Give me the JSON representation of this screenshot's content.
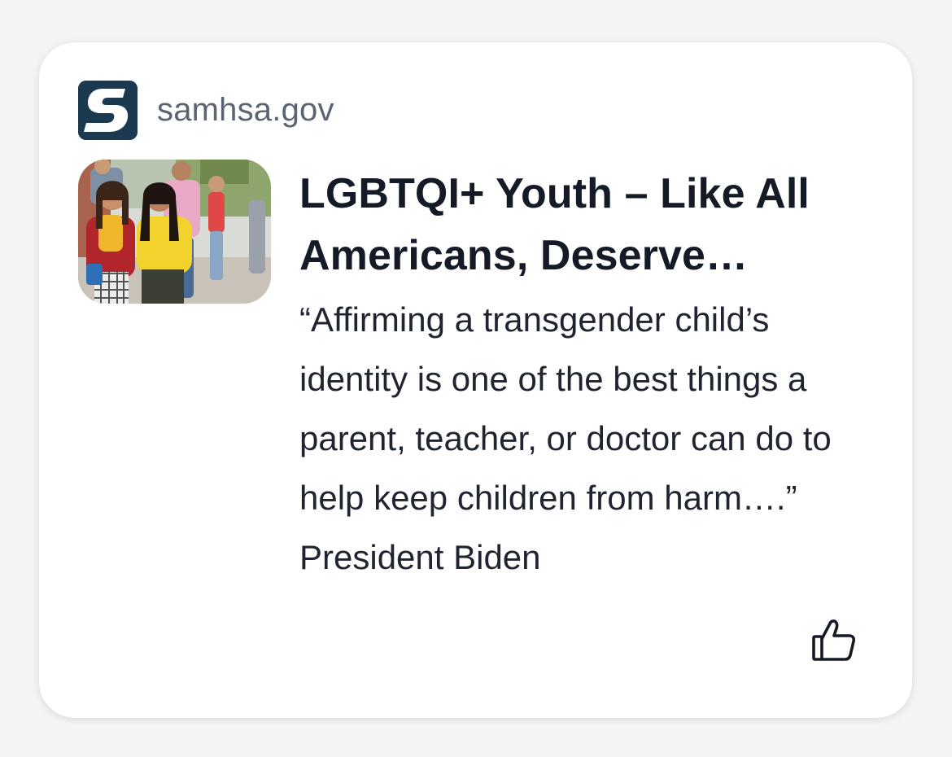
{
  "card": {
    "source": {
      "domain": "samhsa.gov",
      "logo_icon": "samhsa-s-logo",
      "logo_color": "#1c3a4f"
    },
    "thumbnail": {
      "description_icon": "article-photo"
    },
    "title": "LGBTQI+ Youth – Like All Americans, Deserve…",
    "description": "“Affirming a transgender child’s identity is one of the best things a parent, teacher, or doctor can do to help keep children from harm….” President Biden",
    "actions": {
      "like_icon": "thumbs-up-icon"
    }
  }
}
